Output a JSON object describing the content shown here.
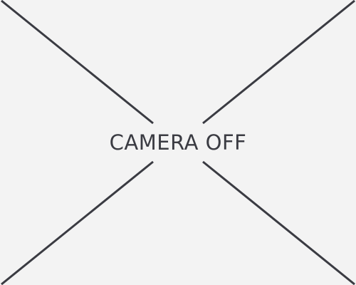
{
  "camera_placeholder": {
    "status_text": "CAMERA OFF",
    "icon": "camera-off-x-icon"
  },
  "colors": {
    "background": "#f3f3f3",
    "foreground": "#3a3b42"
  }
}
